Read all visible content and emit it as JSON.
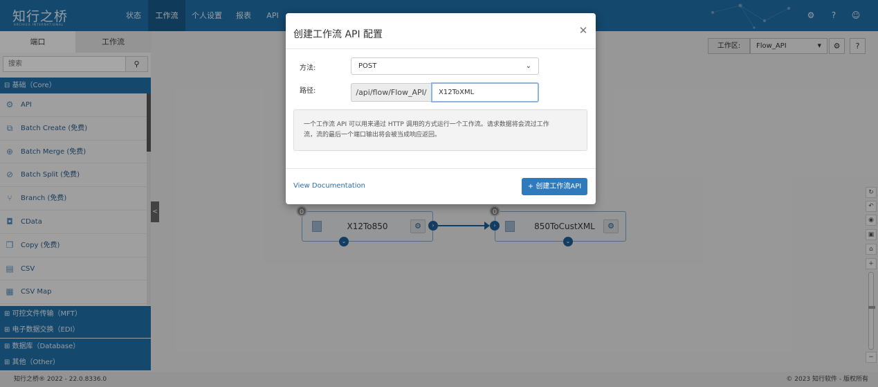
{
  "brand": {
    "logo_text": "知行之桥",
    "logo_sub": "ARCHIEX INTERNATIONAL"
  },
  "nav": {
    "items": [
      {
        "label": "状态"
      },
      {
        "label": "工作流"
      },
      {
        "label": "个人设置"
      },
      {
        "label": "报表"
      },
      {
        "label": "API"
      }
    ],
    "active": "工作流",
    "right_icons": [
      "gear-icon",
      "help-icon",
      "user-icon"
    ]
  },
  "leftpanel": {
    "tabs": [
      {
        "label": "端口"
      },
      {
        "label": "工作流"
      }
    ],
    "search": {
      "placeholder": "搜索"
    },
    "core_header": "⊟ 基础（Core）",
    "items": [
      {
        "label": "API",
        "icon": "api-icon"
      },
      {
        "label": "Batch Create (免费)",
        "icon": "batch-create-icon"
      },
      {
        "label": "Batch Merge (免费)",
        "icon": "batch-merge-icon"
      },
      {
        "label": "Batch Split (免费)",
        "icon": "batch-split-icon"
      },
      {
        "label": "Branch (免费)",
        "icon": "branch-icon"
      },
      {
        "label": "CData",
        "icon": "cdata-icon"
      },
      {
        "label": "Copy (免费)",
        "icon": "copy-icon"
      },
      {
        "label": "CSV",
        "icon": "csv-icon"
      },
      {
        "label": "CSV Map",
        "icon": "csv-map-icon"
      }
    ],
    "categories": [
      {
        "label": "⊞ 可控文件传输（MFT）"
      },
      {
        "label": "⊞ 电子数据交换（EDI）"
      },
      {
        "label": "⊞ 数据库（Database）"
      },
      {
        "label": "⊞ 其他（Other）"
      }
    ]
  },
  "workspace": {
    "label": "工作区:",
    "value": "Flow_API"
  },
  "nodes": [
    {
      "title": "X12To850",
      "badge": "0"
    },
    {
      "title": "850ToCustXML",
      "badge": "0"
    }
  ],
  "footer": {
    "left": "知行之桥® 2022 - 22.0.8336.0",
    "right": "© 2023 知行软件 - 版权所有"
  },
  "modal": {
    "title": "创建工作流 API 配置",
    "method_label": "方法:",
    "method_value": "POST",
    "path_label": "路径:",
    "path_prefix": "/api/flow/Flow_API/",
    "path_value": "X12ToXML",
    "info_line1": "一个工作流 API 可以用来通过 HTTP 调用的方式运行一个工作流。请求数据将会流过工作",
    "info_line2": "流，流的最后一个端口输出将会被当成响应返回。",
    "doc_link": "View Documentation",
    "create_button": "+ 创建工作流API"
  },
  "colors": {
    "primary": "#1f6fa8",
    "button": "#2f79bd",
    "link": "#2a6eae"
  }
}
